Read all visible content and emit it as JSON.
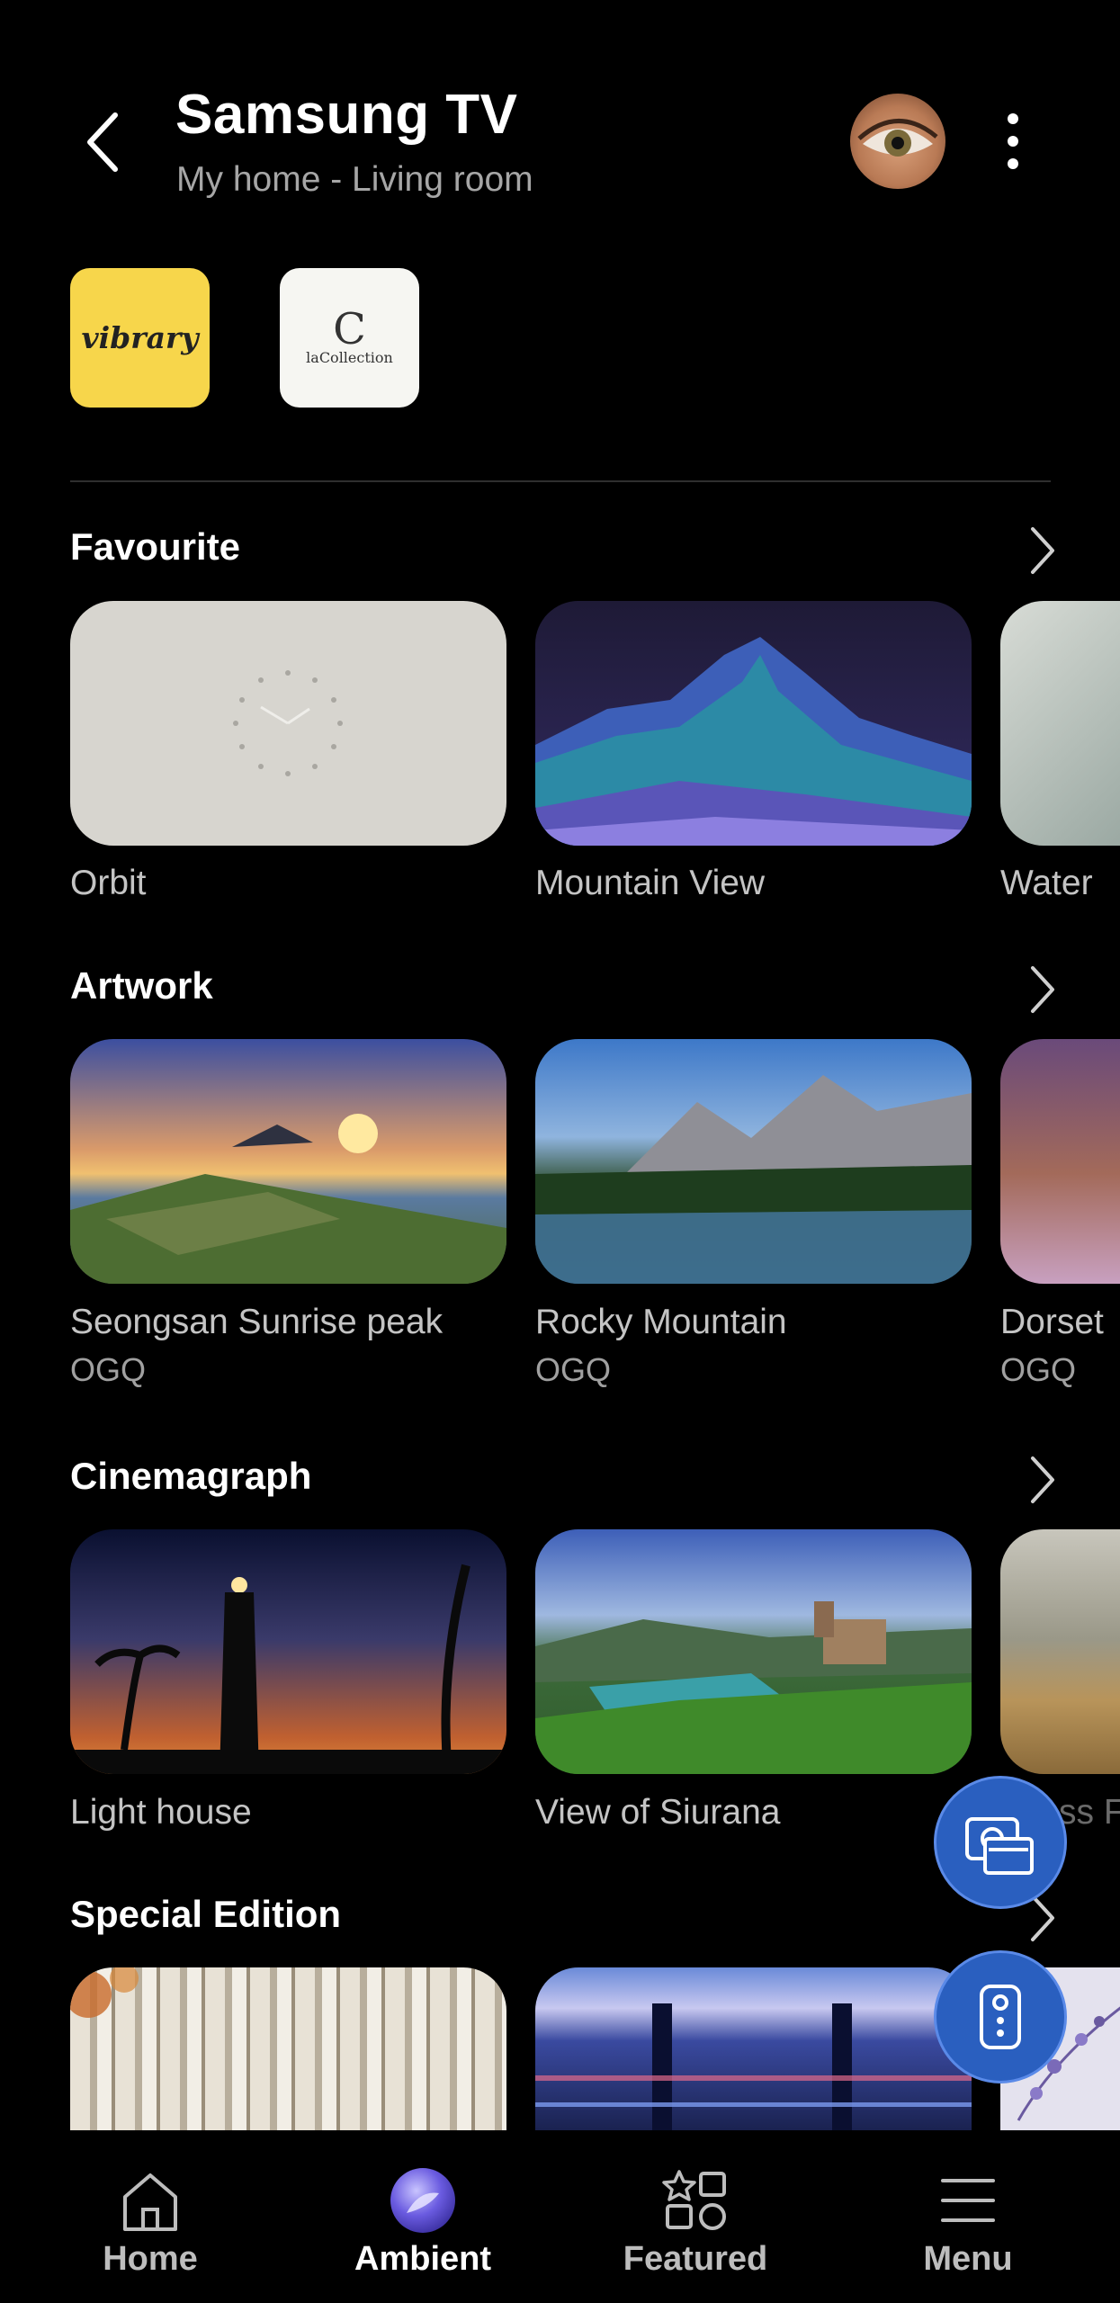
{
  "header": {
    "title": "Samsung TV",
    "subtitle": "My home - Living room"
  },
  "providers": [
    {
      "name": "vibrary",
      "label": "vibrary"
    },
    {
      "name": "laCollection",
      "logo_letter": "C",
      "label": "laCollection"
    }
  ],
  "sections": {
    "favourite": {
      "title": "Favourite",
      "items": [
        {
          "label": "Orbit"
        },
        {
          "label": "Mountain View"
        },
        {
          "label": "Water"
        }
      ]
    },
    "artwork": {
      "title": "Artwork",
      "items": [
        {
          "label": "Seongsan Sunrise peak",
          "sub": "OGQ"
        },
        {
          "label": "Rocky Mountain",
          "sub": "OGQ"
        },
        {
          "label": "Dorset",
          "sub": "OGQ"
        }
      ]
    },
    "cinemagraph": {
      "title": "Cinemagraph",
      "items": [
        {
          "label": "Light house"
        },
        {
          "label": "View of Siurana"
        },
        {
          "label": "Grass F"
        }
      ]
    },
    "special": {
      "title": "Special Edition"
    }
  },
  "fabs": {
    "screenshot": "screenshot-icon",
    "remote": "remote-icon"
  },
  "nav": {
    "items": [
      {
        "label": "Home",
        "icon": "home-icon"
      },
      {
        "label": "Ambient",
        "icon": "ambient-icon",
        "active": true
      },
      {
        "label": "Featured",
        "icon": "featured-icon"
      },
      {
        "label": "Menu",
        "icon": "menu-icon"
      }
    ]
  },
  "colors": {
    "accent": "#2a5fbf",
    "background": "#000000",
    "provider_yellow": "#f7d64b"
  }
}
